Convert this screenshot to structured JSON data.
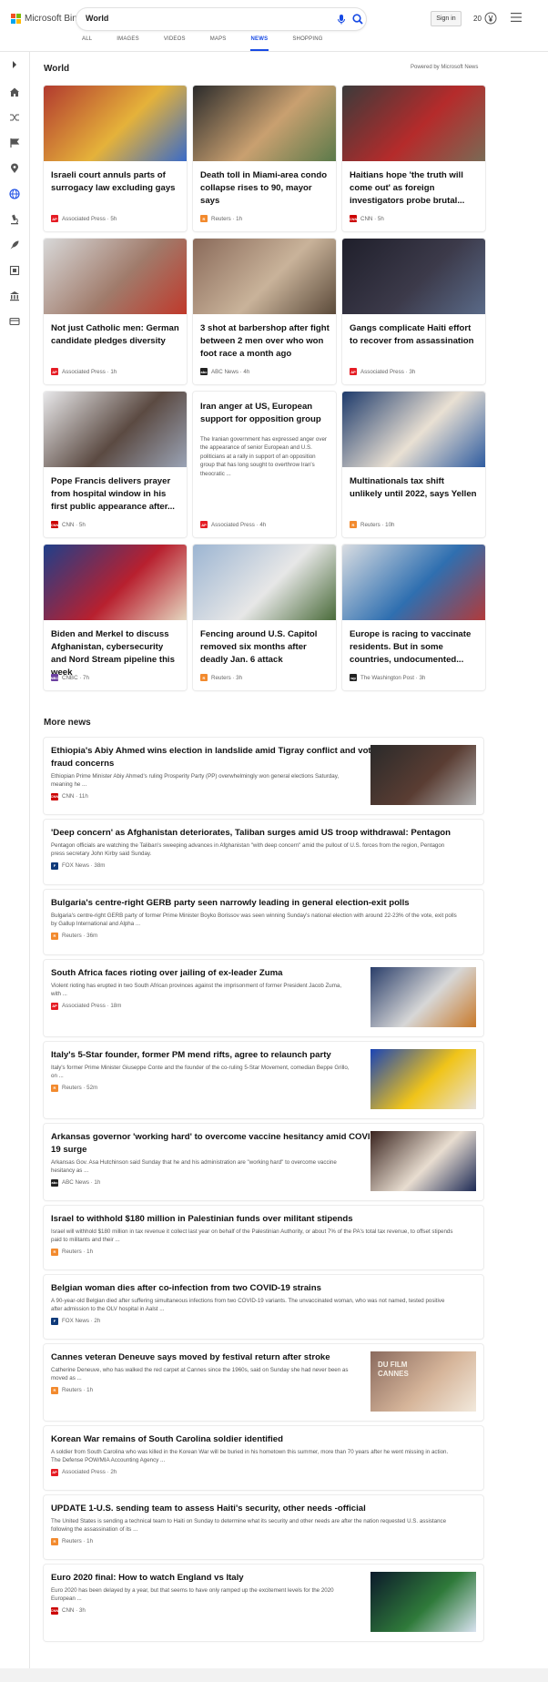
{
  "brand": {
    "name": "Microsoft Bing"
  },
  "search": {
    "value": "World"
  },
  "header": {
    "signin": "Sign in",
    "rewards": "20"
  },
  "tabs": [
    {
      "label": "ALL",
      "active": false
    },
    {
      "label": "IMAGES",
      "active": false
    },
    {
      "label": "VIDEOS",
      "active": false
    },
    {
      "label": "MAPS",
      "active": false
    },
    {
      "label": "NEWS",
      "active": true
    },
    {
      "label": "SHOPPING",
      "active": false
    }
  ],
  "rail_icons": [
    "chevron-right-icon",
    "home-icon",
    "shuffle-icon",
    "flag-icon",
    "location-pin-icon",
    "globe-icon",
    "microscope-icon",
    "rocket-icon",
    "film-icon",
    "building-icon",
    "card-icon"
  ],
  "world": {
    "title": "World",
    "powered": "Powered by Microsoft News"
  },
  "cards": [
    {
      "title": "Israeli court annuls parts of surrogacy law excluding gays",
      "source": "Associated Press",
      "time": "5h",
      "logo": "AP",
      "logo_color": "#e51c24",
      "img": [
        "#b23a2f",
        "#e5b23a",
        "#3a6bc8"
      ]
    },
    {
      "title": "Death toll in Miami-area condo collapse rises to 90, mayor says",
      "source": "Reuters",
      "time": "1h",
      "logo": "R",
      "logo_color": "#f28a2e",
      "img": [
        "#2b2b2b",
        "#c9a070",
        "#5b7a4a"
      ]
    },
    {
      "title": "Haitians hope 'the truth will come out' as foreign investigators probe brutal...",
      "source": "CNN",
      "time": "5h",
      "logo": "CNN",
      "logo_color": "#cc0000",
      "img": [
        "#3b3b3b",
        "#b52b2b",
        "#7a6a55"
      ]
    },
    {
      "title": "Not just Catholic men: German candidate pledges diversity",
      "source": "Associated Press",
      "time": "1h",
      "logo": "AP",
      "logo_color": "#e51c24",
      "img": [
        "#d8d8d8",
        "#a07b6b",
        "#c0392b"
      ]
    },
    {
      "title": "3 shot at barbershop after fight between 2 men over who won foot race a month ago",
      "source": "ABC News",
      "time": "4h",
      "logo": "abc",
      "logo_color": "#222222",
      "img": [
        "#8a6a5a",
        "#c9b39a",
        "#5b4a3a"
      ]
    },
    {
      "title": "Gangs complicate Haiti effort to recover from assassination",
      "source": "Associated Press",
      "time": "3h",
      "logo": "AP",
      "logo_color": "#e51c24",
      "img": [
        "#1f1f2b",
        "#3c3a4a",
        "#5a6a88"
      ]
    },
    {
      "title": "Pope Francis delivers prayer from hospital window in his first public appearance after...",
      "source": "CNN",
      "time": "5h",
      "logo": "CNN",
      "logo_color": "#cc0000",
      "img": [
        "#e8e8ea",
        "#5b4a42",
        "#9aa3b5"
      ]
    },
    {
      "title": "Iran anger at US, European support for opposition group",
      "snippet": "The Iranian government has expressed anger over the appearance of senior European and U.S. politicians at a rally in support of an opposition group that has long sought to overthrow Iran's theocratic ...",
      "source": "Associated Press",
      "time": "4h",
      "logo": "AP",
      "logo_color": "#e51c24",
      "img": null
    },
    {
      "title": "Multinationals tax shift unlikely until 2022, says Yellen",
      "source": "Reuters",
      "time": "10h",
      "logo": "R",
      "logo_color": "#f28a2e",
      "img": [
        "#1d3a6b",
        "#e9e0d3",
        "#2f5ca0"
      ]
    },
    {
      "title": "Biden and Merkel to discuss Afghanistan, cybersecurity and Nord Stream pipeline this week",
      "source": "CNBC",
      "time": "7h",
      "logo": "NBC",
      "logo_color": "#6b3fa0",
      "img": [
        "#1f3f8a",
        "#b8202f",
        "#e5d7c0"
      ]
    },
    {
      "title": "Fencing around U.S. Capitol removed six months after deadly Jan. 6 attack",
      "source": "Reuters",
      "time": "3h",
      "logo": "R",
      "logo_color": "#f28a2e",
      "img": [
        "#9cb5d2",
        "#e7e7e7",
        "#4a6b3a"
      ]
    },
    {
      "title": "Europe is racing to vaccinate residents. But in some countries, undocumented...",
      "source": "The Washington Post",
      "time": "3h",
      "logo": "wp",
      "logo_color": "#222222",
      "img": [
        "#d9dde2",
        "#2f6fb0",
        "#b23a3a"
      ]
    }
  ],
  "more_news": {
    "title": "More news",
    "items": [
      {
        "title_lines": [
          "Ethiopia's Abiy Ahmed wins election in landslide amid Tigray conflict and voting",
          "fraud concerns"
        ],
        "snippet_lines": [
          "Ethiopian Prime Minister Abiy Ahmed's ruling Prosperity Party (PP) overwhelmingly won general elections Saturday,",
          "meaning he ..."
        ],
        "source": "CNN",
        "time": "11h",
        "logo": "CNN",
        "logo_color": "#cc0000",
        "thumb": [
          "#2a2a2a",
          "#5a3d33",
          "#b0b0b0"
        ]
      },
      {
        "title_lines": [
          "'Deep concern' as Afghanistan deteriorates, Taliban surges amid US troop withdrawal: Pentagon"
        ],
        "snippet_lines": [
          "Pentagon officials are watching the Taliban's sweeping advances in Afghanistan \"with deep concern\" amid the pullout of U.S. forces from the region, Pentagon",
          "press secretary John Kirby said Sunday."
        ],
        "source": "FOX News",
        "time": "38m",
        "logo": "F",
        "logo_color": "#0f3a7a",
        "thumb": null
      },
      {
        "title_lines": [
          "Bulgaria's centre-right GERB party seen narrowly leading in general election-exit polls"
        ],
        "snippet_lines": [
          "Bulgaria's centre-right GERB party of former Prime Minister Boyko Borissov was seen winning Sunday's national election with around 22-23% of the vote, exit polls",
          "by Gallup International and Alpha ..."
        ],
        "source": "Reuters",
        "time": "36m",
        "logo": "R",
        "logo_color": "#f28a2e",
        "thumb": null
      },
      {
        "title_lines": [
          "South Africa faces rioting over jailing of ex-leader Zuma"
        ],
        "snippet_lines": [
          "Violent rioting has erupted in two South African provinces against the imprisonment of former President Jacob Zuma,",
          "with ..."
        ],
        "source": "Associated Press",
        "time": "18m",
        "logo": "AP",
        "logo_color": "#e51c24",
        "thumb": [
          "#2a3e6a",
          "#d7d7d7",
          "#c97a2b"
        ]
      },
      {
        "title_lines": [
          "Italy's 5-Star founder, former PM mend rifts, agree to relaunch party"
        ],
        "snippet_lines": [
          "Italy's former Prime Minister Giuseppe Conte and the founder of the co-ruling 5-Star Movement, comedian Beppe Grillo,",
          "on ..."
        ],
        "source": "Reuters",
        "time": "52m",
        "logo": "R",
        "logo_color": "#f28a2e",
        "thumb": [
          "#1a44b5",
          "#f0c419",
          "#e8e1d8"
        ]
      },
      {
        "title_lines": [
          "Arkansas governor 'working hard' to overcome vaccine hesitancy amid COVID-",
          "19 surge"
        ],
        "snippet_lines": [
          "Arkansas Gov. Asa Hutchinson said Sunday that he and his administration are \"working hard\" to overcome vaccine",
          "hesitancy as ..."
        ],
        "source": "ABC News",
        "time": "1h",
        "logo": "abc",
        "logo_color": "#222222",
        "thumb": [
          "#3b2520",
          "#e8ddd0",
          "#1d2a55"
        ]
      },
      {
        "title_lines": [
          "Israel to withhold $180 million in Palestinian funds over militant stipends"
        ],
        "snippet_lines": [
          "Israel will withhold $180 million in tax revenue it collect last year on behalf of the Palestinian Authority, or about 7% of the PA's total tax revenue, to offset stipends",
          "paid to militants and their ..."
        ],
        "source": "Reuters",
        "time": "1h",
        "logo": "R",
        "logo_color": "#f28a2e",
        "thumb": null
      },
      {
        "title_lines": [
          "Belgian woman dies after co-infection from two COVID-19 strains"
        ],
        "snippet_lines": [
          "A 90-year-old Belgian died after suffering simultaneous infections from two COVID-19 variants.  The unvaccinated woman, who was not named, tested positive",
          "after admission to the OLV hospital in Aalst ..."
        ],
        "source": "FOX News",
        "time": "2h",
        "logo": "F",
        "logo_color": "#0f3a7a",
        "thumb": null
      },
      {
        "title_lines": [
          "Cannes veteran Deneuve says moved by festival return after stroke"
        ],
        "snippet_lines": [
          "Catherine Deneuve, who has walked the red carpet at Cannes since the 1960s, said on Sunday she had never been as",
          "moved as ..."
        ],
        "source": "Reuters",
        "time": "1h",
        "logo": "R",
        "logo_color": "#f28a2e",
        "thumb": [
          "#8a6a5e",
          "#d6b59a",
          "#f2e9dc"
        ],
        "thumb_text": [
          "DU FILM",
          "CANNES"
        ]
      },
      {
        "title_lines": [
          "Korean War remains of South Carolina soldier identified"
        ],
        "snippet_lines": [
          "A soldier from South Carolina who was killed in the Korean War will be buried in his hometown this summer, more than 70 years after he went missing in action.",
          "The Defense POW/MIA Accounting Agency ..."
        ],
        "source": "Associated Press",
        "time": "2h",
        "logo": "AP",
        "logo_color": "#e51c24",
        "thumb": null
      },
      {
        "title_lines": [
          "UPDATE 1-U.S. sending team to assess Haiti's security, other needs -official"
        ],
        "snippet_lines": [
          "The United States is sending a technical team to Haiti on Sunday to determine what its security and other needs are after the nation requested U.S. assistance",
          "following the assassination of its ..."
        ],
        "source": "Reuters",
        "time": "1h",
        "logo": "R",
        "logo_color": "#f28a2e",
        "thumb": null
      },
      {
        "title_lines": [
          "Euro 2020 final: How to watch England vs Italy"
        ],
        "snippet_lines": [
          "Euro 2020 has been delayed by a year, but that seems to have only ramped up the excitement levels for the 2020",
          "European ..."
        ],
        "source": "CNN",
        "time": "3h",
        "logo": "CNN",
        "logo_color": "#cc0000",
        "thumb": [
          "#0c1a2b",
          "#2f7a3a",
          "#d8e2f0"
        ]
      }
    ]
  }
}
